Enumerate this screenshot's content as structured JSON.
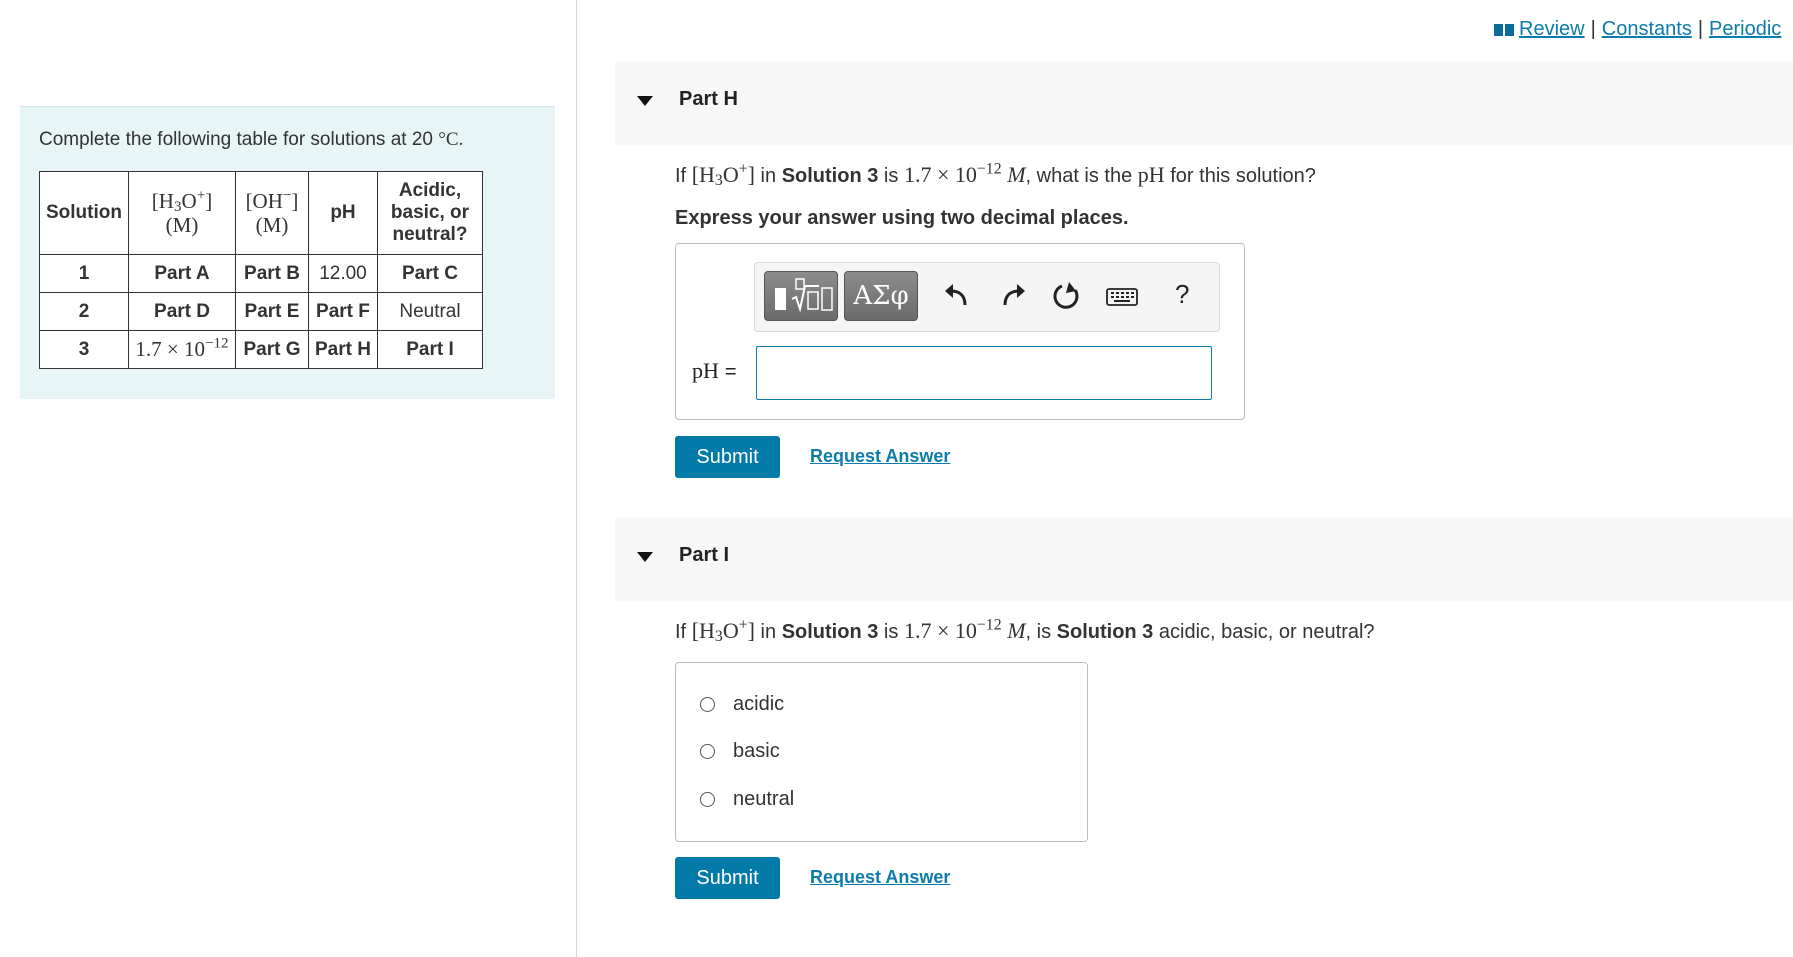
{
  "top_links": {
    "review": "Review",
    "constants": "Constants",
    "periodic": "Periodic",
    "separator": "|"
  },
  "intro": {
    "text_prefix": "Complete the following table for solutions at 20",
    "text_unit": "°C."
  },
  "table": {
    "headers": {
      "solution": "Solution",
      "h3o_unit": "(M)",
      "oh_unit": "(M)",
      "ph": "pH",
      "acidity_line1": "Acidic,",
      "acidity_line2": "basic, or",
      "acidity_line3": "neutral?"
    },
    "rows": [
      {
        "solution": "1",
        "h3o": "Part A",
        "oh": "Part B",
        "ph": "12.00",
        "acidity": "Part C"
      },
      {
        "solution": "2",
        "h3o": "Part D",
        "oh": "Part E",
        "ph": "Part F",
        "acidity": "Neutral"
      },
      {
        "solution": "3",
        "h3o_mantissa": "1.7 × 10",
        "h3o_exponent": "−12",
        "oh": "Part G",
        "ph": "Part H",
        "acidity": "Part I"
      }
    ]
  },
  "part_h": {
    "title": "Part H",
    "question": {
      "if": "If",
      "in": "in",
      "solution": "Solution 3",
      "is": "is",
      "value": "1.7 × 10",
      "exponent": "−12",
      "unit": "M",
      "rest1": ", what is the",
      "ph": "pH",
      "rest2": "for this solution?"
    },
    "instruction": "Express your answer using two decimal places.",
    "toolbar": {
      "symbols_label": "ΑΣφ",
      "help_label": "?"
    },
    "answer_label": "pH",
    "answer_eq": "=",
    "answer_value": "",
    "submit_label": "Submit",
    "request_label": "Request Answer"
  },
  "part_i": {
    "title": "Part I",
    "question": {
      "if": "If",
      "in": "in",
      "solution": "Solution 3",
      "is": "is",
      "value": "1.7 × 10",
      "exponent": "−12",
      "unit": "M",
      "rest1": ", is",
      "solution2": "Solution 3",
      "rest2": "acidic, basic, or neutral?"
    },
    "choices": [
      "acidic",
      "basic",
      "neutral"
    ],
    "submit_label": "Submit",
    "request_label": "Request Answer"
  },
  "colors": {
    "accent": "#047aa8",
    "link": "#0c7cab",
    "intro_bg": "#e8f5f6",
    "header_bg": "#f7f7f7"
  }
}
